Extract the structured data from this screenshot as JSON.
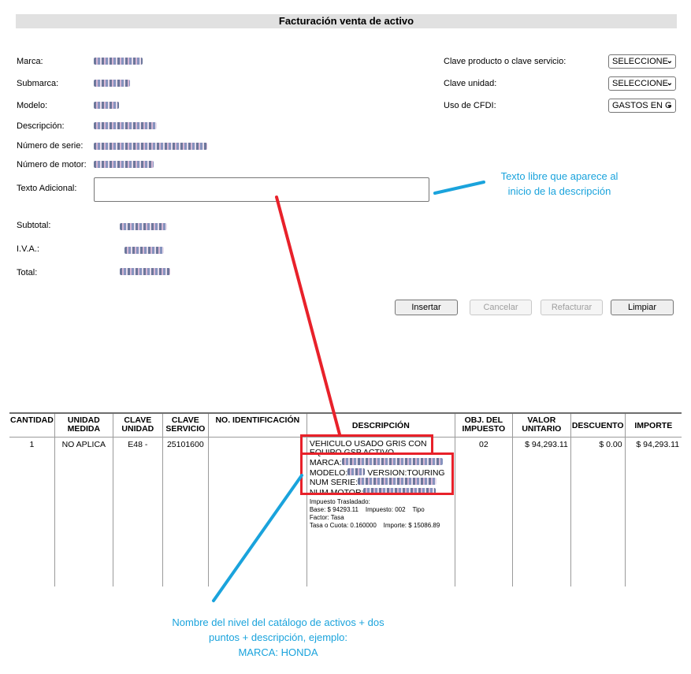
{
  "header": {
    "title": "Facturación venta de activo"
  },
  "form": {
    "labels": {
      "marca": "Marca:",
      "submarca": "Submarca:",
      "modelo": "Modelo:",
      "descripcion": "Descripción:",
      "numero_serie": "Número de serie:",
      "numero_motor": "Número de motor:",
      "texto_adicional": "Texto Adicional:",
      "subtotal": "Subtotal:",
      "iva": "I.V.A.:",
      "total": "Total:"
    },
    "right_labels": {
      "clave_producto": "Clave producto o clave servicio:",
      "clave_unidad": "Clave unidad:",
      "uso_cfdi": "Uso de CFDI:"
    },
    "selects": {
      "clave_producto": "SELECCIONE",
      "clave_unidad": "SELECCIONE",
      "uso_cfdi": "GASTOS EN G"
    },
    "texto_adicional_value": ""
  },
  "buttons": {
    "insertar": "Insertar",
    "cancelar": "Cancelar",
    "refacturar": "Refacturar",
    "limpiar": "Limpiar"
  },
  "annotations": {
    "texto_libre": [
      "Texto libre que aparece al",
      "inicio de la descripción"
    ],
    "nombre_nivel": [
      "Nombre del nivel del catálogo de activos + dos",
      "puntos + descripción, ejemplo:",
      "MARCA: HONDA"
    ]
  },
  "table": {
    "headers": {
      "cantidad": "CANTIDAD",
      "unidad_medida": [
        "UNIDAD",
        "MEDIDA"
      ],
      "clave_unidad": [
        "CLAVE",
        "UNIDAD"
      ],
      "clave_servicio": [
        "CLAVE",
        "SERVICIO"
      ],
      "no_identificacion": "NO. IDENTIFICACIÓN",
      "descripcion": "DESCRIPCIÓN",
      "obj_impuesto": [
        "OBJ. DEL",
        "IMPUESTO"
      ],
      "valor_unitario": [
        "VALOR",
        "UNITARIO"
      ],
      "descuento": "DESCUENTO",
      "importe": "IMPORTE"
    },
    "row": {
      "cantidad": "1",
      "unidad_medida": "NO APLICA",
      "clave_unidad": "E48 -",
      "clave_servicio": "25101600",
      "no_identificacion": "",
      "desc_line1": "VEHICULO USADO GRIS CON",
      "desc_line2": "EQUIPO GSP ACTIVO",
      "desc_marca": "MARCA:",
      "desc_modelo": "MODELO:",
      "desc_version": "VERSION:TOURING",
      "desc_serie": "NUM SERIE:",
      "desc_motor": "NUM MOTOR:",
      "tax_title": "Impuesto Trasladado:",
      "tax_base": "Base: $ 94293.11",
      "tax_impuesto": "Impuesto: 002",
      "tax_tipo": "Tipo",
      "tax_factor": "Factor: Tasa",
      "tax_tasa": "Tasa o Cuota: 0.160000",
      "tax_importe": "Importe: $ 15086.89",
      "obj_impuesto": "02",
      "valor_unitario": "$ 94,293.11",
      "descuento": "$ 0.00",
      "importe": "$ 94,293.11"
    }
  }
}
